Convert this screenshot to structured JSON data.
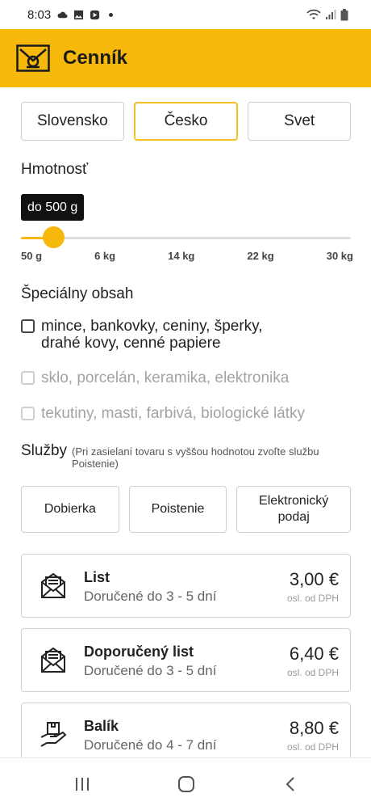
{
  "status_bar": {
    "time": "8:03",
    "icons_left": [
      "cloud-icon",
      "photo-icon",
      "play-icon",
      "dot-icon"
    ],
    "icons_right": [
      "wifi-icon",
      "signal-icon",
      "battery-icon"
    ]
  },
  "app_bar": {
    "title": "Cenník",
    "logo": "post-horn-logo"
  },
  "region_tabs": [
    {
      "label": "Slovensko",
      "active": false
    },
    {
      "label": "Česko",
      "active": true
    },
    {
      "label": "Svet",
      "active": false
    }
  ],
  "weight": {
    "title": "Hmotnosť",
    "selected_label": "do 500 g",
    "ticks": [
      "50 g",
      "6 kg",
      "14 kg",
      "22 kg",
      "30 kg"
    ],
    "accent_color": "#f6b80a"
  },
  "special_content": {
    "title": "Špeciálny obsah",
    "options": [
      {
        "label": "mince, bankovky, ceniny, šperky, drahé kovy, cenné papiere",
        "checked": false,
        "enabled": true
      },
      {
        "label": "sklo, porcelán, keramika, elektronika",
        "checked": false,
        "enabled": false
      },
      {
        "label": "tekutiny, masti, farbivá, biologické látky",
        "checked": false,
        "enabled": false
      }
    ]
  },
  "services": {
    "title": "Služby",
    "note": "(Pri zasielaní tovaru s vyššou hodnotou zvoľte službu Poistenie)",
    "buttons": [
      {
        "label": "Dobierka"
      },
      {
        "label": "Poistenie"
      },
      {
        "label": "Elektronický podaj"
      }
    ]
  },
  "products": [
    {
      "name": "List",
      "delivery": "Doručené do 3 - 5 dní",
      "price": "3,00 €",
      "vat": "osl. od DPH",
      "icon": "envelope-icon"
    },
    {
      "name": "Doporučený list",
      "delivery": "Doručené do 3 - 5 dní",
      "price": "6,40 €",
      "vat": "osl. od DPH",
      "icon": "registered-envelope-icon"
    },
    {
      "name": "Balík",
      "delivery": "Doručené do 4 - 7 dní",
      "price": "8,80 €",
      "vat": "osl. od DPH",
      "icon": "parcel-hand-icon"
    }
  ],
  "colors": {
    "brand_yellow": "#f6b80a",
    "active_tab_border": "#f3c124"
  }
}
